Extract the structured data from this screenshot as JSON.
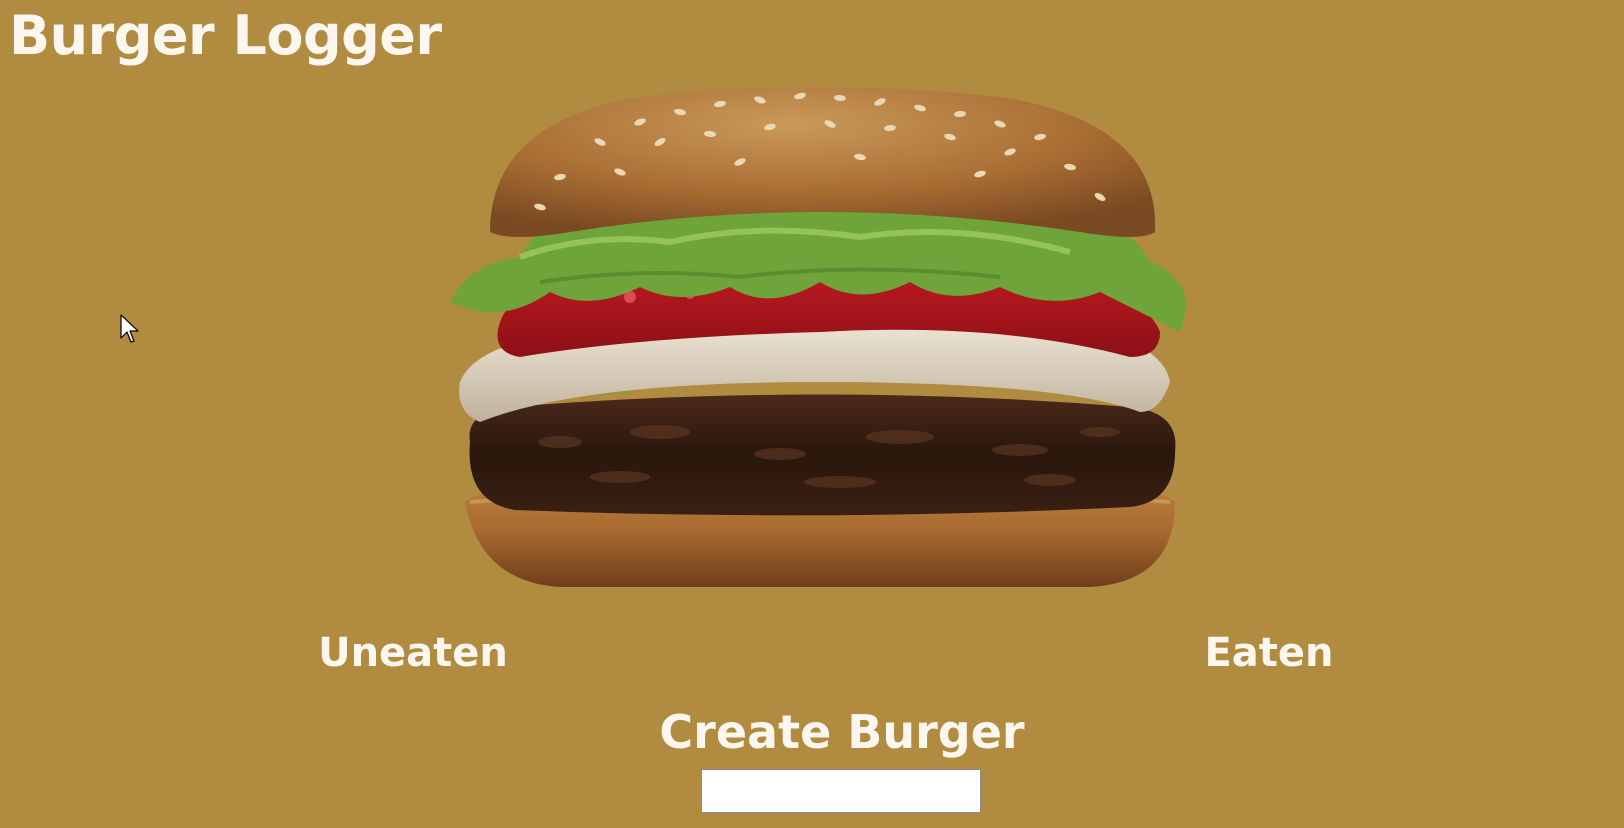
{
  "header": {
    "title": "Burger Logger"
  },
  "columns": {
    "uneaten_label": "Uneaten",
    "eaten_label": "Eaten"
  },
  "create": {
    "heading": "Create Burger",
    "input_value": "",
    "input_placeholder": ""
  },
  "colors": {
    "background": "#b08b40",
    "text": "#fbf6ee",
    "input_background": "#ffffff"
  },
  "icons": {
    "cursor": "mouse-pointer-icon",
    "hero": "burger-image"
  }
}
